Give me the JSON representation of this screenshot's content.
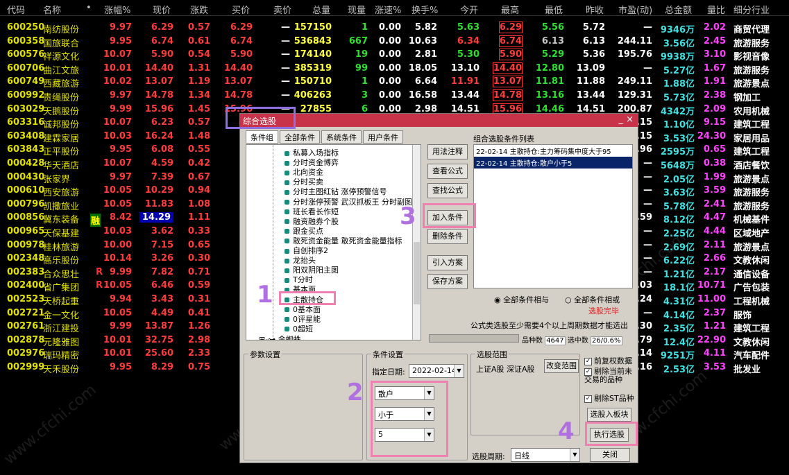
{
  "headers": [
    "代码",
    "名称",
    "•",
    "涨幅%",
    "现价",
    "涨跌",
    "买价",
    "卖价",
    "总量",
    "现量",
    "涨速%",
    "换手%",
    "今开",
    "最高",
    "最低",
    "昨收",
    "市盈(动)",
    "总金额",
    "量比",
    "细分行业"
  ],
  "rows": [
    {
      "code": "600250",
      "name": "南纺股份",
      "flag": "",
      "tag": "",
      "chg": "9.97",
      "price": "6.29",
      "diff": "0.57",
      "bid": "6.29",
      "ask": "—",
      "vol": "157150",
      "cur": "1",
      "spd": "0.00",
      "turn": "5.82",
      "open": "5.63",
      "high": "6.29",
      "low": "5.56",
      "prev": "5.72",
      "pe": "—",
      "amt": "9346万",
      "ratio": "2.02",
      "ind": "商贸代理",
      "openc": "green",
      "lowc": "green"
    },
    {
      "code": "600358",
      "name": "国旅联合",
      "flag": "",
      "tag": "",
      "chg": "9.95",
      "price": "6.74",
      "diff": "0.61",
      "bid": "6.74",
      "ask": "—",
      "vol": "536843",
      "cur": "667",
      "spd": "0.00",
      "turn": "10.63",
      "open": "6.34",
      "high": "6.74",
      "low": "6.13",
      "prev": "6.13",
      "pe": "244.11",
      "amt": "3.56亿",
      "ratio": "2.45",
      "ind": "旅游服务",
      "openc": "red",
      "lowc": "gray"
    },
    {
      "code": "600576",
      "name": "祥源文化",
      "flag": "",
      "tag": "",
      "chg": "10.07",
      "price": "5.90",
      "diff": "0.54",
      "bid": "5.90",
      "ask": "—",
      "vol": "174140",
      "cur": "19",
      "spd": "0.00",
      "turn": "2.81",
      "open": "5.30",
      "high": "5.90",
      "low": "5.29",
      "prev": "5.36",
      "pe": "195.76",
      "amt": "9938万",
      "ratio": "3.10",
      "ind": "影视音像",
      "openc": "green",
      "lowc": "green"
    },
    {
      "code": "600706",
      "name": "曲江文旅",
      "flag": "",
      "tag": "",
      "chg": "10.01",
      "price": "14.40",
      "diff": "1.31",
      "bid": "14.40",
      "ask": "—",
      "vol": "385319",
      "cur": "99",
      "spd": "0.00",
      "turn": "18.05",
      "open": "13.10",
      "high": "14.40",
      "low": "12.80",
      "prev": "13.09",
      "pe": "—",
      "amt": "5.27亿",
      "ratio": "1.67",
      "ind": "旅游服务",
      "openc": "white",
      "lowc": "green"
    },
    {
      "code": "600749",
      "name": "西藏旅游",
      "flag": "",
      "tag": "",
      "chg": "10.02",
      "price": "13.07",
      "diff": "1.19",
      "bid": "13.07",
      "ask": "—",
      "vol": "150710",
      "cur": "1",
      "spd": "0.00",
      "turn": "6.64",
      "open": "11.91",
      "high": "13.07",
      "low": "11.81",
      "prev": "11.88",
      "pe": "249.11",
      "amt": "1.88亿",
      "ratio": "1.91",
      "ind": "旅游景点",
      "openc": "red",
      "lowc": "green"
    },
    {
      "code": "600992",
      "name": "贵绳股份",
      "flag": "",
      "tag": "",
      "chg": "9.97",
      "price": "14.78",
      "diff": "1.34",
      "bid": "14.78",
      "ask": "—",
      "vol": "406263",
      "cur": "3",
      "spd": "0.00",
      "turn": "16.58",
      "open": "13.44",
      "high": "14.78",
      "low": "13.16",
      "prev": "13.44",
      "pe": "129.31",
      "amt": "5.73亿",
      "ratio": "2.38",
      "ind": "钢加工",
      "openc": "white",
      "lowc": "green"
    },
    {
      "code": "603029",
      "name": "天鹅股份",
      "flag": "",
      "tag": "",
      "chg": "9.99",
      "price": "15.96",
      "diff": "1.45",
      "bid": "15.96",
      "ask": "—",
      "vol": "27855",
      "cur": "6",
      "spd": "0.00",
      "turn": "2.98",
      "open": "14.51",
      "high": "15.96",
      "low": "14.46",
      "prev": "14.51",
      "pe": "200.87",
      "amt": "4342万",
      "ratio": "2.09",
      "ind": "农用机械",
      "openc": "white",
      "lowc": "green"
    },
    {
      "code": "603316",
      "name": "诚邦股份",
      "flag": "",
      "tag": "",
      "chg": "10.07",
      "price": "6.23",
      "diff": "0.57",
      "bid": "",
      "ask": "",
      "vol": "",
      "cur": "",
      "spd": "",
      "turn": "",
      "open": "",
      "high": "",
      "low": "",
      "prev": "",
      "pe": ".15",
      "amt": "1.10亿",
      "ratio": "9.15",
      "ind": "建筑工程",
      "openc": "red",
      "lowc": "green"
    },
    {
      "code": "603408",
      "name": "建霖家居",
      "flag": "",
      "tag": "",
      "chg": "10.03",
      "price": "16.24",
      "diff": "1.48",
      "bid": "16",
      "ask": "",
      "vol": "",
      "cur": "",
      "spd": "",
      "turn": "",
      "open": "",
      "high": "",
      "low": "",
      "prev": "",
      "pe": ".15",
      "amt": "3.53亿",
      "ratio": "24.30",
      "ind": "家居用品",
      "openc": "red",
      "lowc": "green"
    },
    {
      "code": "603843",
      "name": "正平股份",
      "flag": "",
      "tag": "",
      "chg": "9.95",
      "price": "6.08",
      "diff": "0.55",
      "bid": "6",
      "ask": "",
      "vol": "",
      "cur": "",
      "spd": "",
      "turn": "",
      "open": "",
      "high": "",
      "low": "",
      "prev": "",
      "pe": ".96",
      "amt": "2595万",
      "ratio": "0.65",
      "ind": "建筑工程",
      "openc": "red",
      "lowc": "green"
    },
    {
      "code": "000428",
      "name": "华天酒店",
      "flag": "",
      "tag": "",
      "chg": "10.07",
      "price": "4.59",
      "diff": "0.42",
      "bid": "",
      "ask": "",
      "vol": "",
      "cur": "",
      "spd": "",
      "turn": "",
      "open": "",
      "high": "",
      "low": "",
      "prev": "",
      "pe": "—",
      "amt": "5648万",
      "ratio": "0.38",
      "ind": "酒店餐饮",
      "openc": "red",
      "lowc": "green"
    },
    {
      "code": "000430",
      "name": "张家界",
      "flag": "",
      "tag": "",
      "chg": "9.97",
      "price": "7.39",
      "diff": "0.67",
      "bid": "",
      "ask": "",
      "vol": "",
      "cur": "",
      "spd": "",
      "turn": "",
      "open": "",
      "high": "",
      "low": "",
      "prev": "",
      "pe": "—",
      "amt": "2.05亿",
      "ratio": "1.99",
      "ind": "旅游景点",
      "openc": "red",
      "lowc": "green"
    },
    {
      "code": "000610",
      "name": "西安旅游",
      "flag": "",
      "tag": "",
      "chg": "10.05",
      "price": "10.29",
      "diff": "0.94",
      "bid": "10",
      "ask": "",
      "vol": "",
      "cur": "",
      "spd": "",
      "turn": "",
      "open": "",
      "high": "",
      "low": "",
      "prev": "",
      "pe": "—",
      "amt": "3.63亿",
      "ratio": "3.59",
      "ind": "旅游服务",
      "openc": "red",
      "lowc": "green"
    },
    {
      "code": "000796",
      "name": "凯撒旅业",
      "flag": "",
      "tag": "",
      "chg": "10.05",
      "price": "11.83",
      "diff": "1.08",
      "bid": "11",
      "ask": "",
      "vol": "",
      "cur": "",
      "spd": "",
      "turn": "",
      "open": "",
      "high": "",
      "low": "",
      "prev": "",
      "pe": "—",
      "amt": "5.78亿",
      "ratio": "2.41",
      "ind": "旅游服务",
      "openc": "red",
      "lowc": "green"
    },
    {
      "code": "000856",
      "name": "冀东装备",
      "flag": "",
      "tag": "融",
      "chg": "8.42",
      "price": "14.29",
      "diff": "1.11",
      "bid": "14",
      "ask": "",
      "vol": "",
      "cur": "",
      "spd": "",
      "turn": "",
      "open": "",
      "high": "",
      "low": "",
      "prev": "",
      "pe": ".59",
      "amt": "8.12亿",
      "ratio": "4.47",
      "ind": "机械基件",
      "openc": "red",
      "lowc": "green"
    },
    {
      "code": "000965",
      "name": "天保基建",
      "flag": "",
      "tag": "",
      "chg": "10.03",
      "price": "3.62",
      "diff": "0.33",
      "bid": "",
      "ask": "",
      "vol": "",
      "cur": "",
      "spd": "",
      "turn": "",
      "open": "",
      "high": "",
      "low": "",
      "prev": "",
      "pe": "—",
      "amt": "2.25亿",
      "ratio": "4.44",
      "ind": "区域地产",
      "openc": "red",
      "lowc": "green"
    },
    {
      "code": "000978",
      "name": "桂林旅游",
      "flag": "",
      "tag": "",
      "chg": "10.00",
      "price": "7.15",
      "diff": "0.65",
      "bid": "",
      "ask": "",
      "vol": "",
      "cur": "",
      "spd": "",
      "turn": "",
      "open": "",
      "high": "",
      "low": "",
      "prev": "",
      "pe": "—",
      "amt": "2.69亿",
      "ratio": "2.11",
      "ind": "旅游景点",
      "openc": "red",
      "lowc": "green"
    },
    {
      "code": "002348",
      "name": "高乐股份",
      "flag": "",
      "tag": "",
      "chg": "10.14",
      "price": "3.26",
      "diff": "0.30",
      "bid": "",
      "ask": "",
      "vol": "",
      "cur": "",
      "spd": "",
      "turn": "",
      "open": "",
      "high": "",
      "low": "",
      "prev": "",
      "pe": "—",
      "amt": "6.22亿",
      "ratio": "2.66",
      "ind": "文教休闲",
      "openc": "red",
      "lowc": "green"
    },
    {
      "code": "002383",
      "name": "合众思壮",
      "flag": "R",
      "tag": "",
      "chg": "9.99",
      "price": "7.82",
      "diff": "0.71",
      "bid": "",
      "ask": "",
      "vol": "",
      "cur": "",
      "spd": "",
      "turn": "",
      "open": "",
      "high": "",
      "low": "",
      "prev": "",
      "pe": "—",
      "amt": "1.21亿",
      "ratio": "2.17",
      "ind": "通信设备",
      "openc": "red",
      "lowc": "green"
    },
    {
      "code": "002400",
      "name": "省广集团",
      "flag": "R",
      "tag": "",
      "chg": "10.05",
      "price": "6.46",
      "diff": "0.59",
      "bid": "",
      "ask": "",
      "vol": "",
      "cur": "",
      "spd": "",
      "turn": "",
      "open": "",
      "high": "",
      "low": "",
      "prev": "",
      "pe": ".03",
      "amt": "18.1亿",
      "ratio": "10.71",
      "ind": "广告包装",
      "openc": "red",
      "lowc": "green"
    },
    {
      "code": "002523",
      "name": "天桥起重",
      "flag": "",
      "tag": "",
      "chg": "9.94",
      "price": "3.43",
      "diff": "0.31",
      "bid": "",
      "ask": "",
      "vol": "",
      "cur": "",
      "spd": "",
      "turn": "",
      "open": "",
      "high": "",
      "low": "",
      "prev": "",
      "pe": ".24",
      "amt": "4.31亿",
      "ratio": "11.00",
      "ind": "工程机械",
      "openc": "red",
      "lowc": "green"
    },
    {
      "code": "002721",
      "name": "金一文化",
      "flag": "",
      "tag": "",
      "chg": "10.05",
      "price": "4.49",
      "diff": "0.41",
      "bid": "",
      "ask": "",
      "vol": "",
      "cur": "",
      "spd": "",
      "turn": "",
      "open": "",
      "high": "",
      "low": "",
      "prev": "",
      "pe": "—",
      "amt": "4.14亿",
      "ratio": "2.37",
      "ind": "服饰",
      "openc": "red",
      "lowc": "green"
    },
    {
      "code": "002761",
      "name": "浙江建投",
      "flag": "",
      "tag": "",
      "chg": "9.99",
      "price": "13.87",
      "diff": "1.26",
      "bid": "13",
      "ask": "",
      "vol": "",
      "cur": "",
      "spd": "",
      "turn": "",
      "open": "",
      "high": "",
      "low": "",
      "prev": "",
      "pe": ".30",
      "amt": "2.35亿",
      "ratio": "1.21",
      "ind": "建筑工程",
      "openc": "red",
      "lowc": "green"
    },
    {
      "code": "002878",
      "name": "元隆雅图",
      "flag": "",
      "tag": "",
      "chg": "10.01",
      "price": "32.75",
      "diff": "2.98",
      "bid": "32",
      "ask": "",
      "vol": "",
      "cur": "",
      "spd": "",
      "turn": "",
      "open": "",
      "high": "",
      "low": "",
      "prev": "",
      "pe": ".79",
      "amt": "12.4亿",
      "ratio": "22.90",
      "ind": "文教休闲",
      "openc": "red",
      "lowc": "green"
    },
    {
      "code": "002976",
      "name": "瑞玛精密",
      "flag": "",
      "tag": "",
      "chg": "10.01",
      "price": "25.60",
      "diff": "2.33",
      "bid": "25",
      "ask": "",
      "vol": "",
      "cur": "",
      "spd": "",
      "turn": "",
      "open": "",
      "high": "",
      "low": "",
      "prev": "",
      "pe": ".14",
      "amt": "9251万",
      "ratio": "4.11",
      "ind": "汽车配件",
      "openc": "red",
      "lowc": "green"
    },
    {
      "code": "002999",
      "name": "天禾股份",
      "flag": "",
      "tag": "",
      "chg": "9.95",
      "price": "8.29",
      "diff": "0.75",
      "bid": "8",
      "ask": "",
      "vol": "",
      "cur": "",
      "spd": "",
      "turn": "",
      "open": "",
      "high": "",
      "low": "",
      "prev": "",
      "pe": ".16",
      "amt": "2.53亿",
      "ratio": "3.53",
      "ind": "批发业",
      "openc": "red",
      "lowc": "green"
    }
  ],
  "dialog": {
    "title": "综合选股",
    "title_ctl": "_ ×",
    "tabs": [
      "条件组",
      "全部条件",
      "系统条件",
      "用户条件"
    ],
    "tree_items": [
      "私募入场指标",
      "分时资金博弈",
      "北向资金",
      "分时买卖",
      "分时主图红钻 涨停预警信号",
      "分时涨停预警 武汉抓板王 分时副图",
      "班长看长作短",
      "融资融券个股",
      "跟金买点",
      "敢死资金能量 敢死资金能量指标",
      "自创排序2",
      "龙抬头",
      "阳双阴阳主图",
      "T分时",
      "基本面",
      "主散持仓",
      "0基本面",
      "0评星能",
      "0超短"
    ],
    "tree_group": "金蜘蛛",
    "buttons": {
      "usage": "用法注释",
      "view_formula": "查看公式",
      "find_formula": "查找公式",
      "add_condition": "加入条件",
      "delete_condition": "删除条件",
      "import_plan": "引入方案",
      "save_plan": "保存方案",
      "change_range": "改变范围",
      "to_block": "选股入板块",
      "run": "执行选股",
      "close": "关闭"
    },
    "list_title": "组合选股条件列表",
    "list_items": [
      "22-02-14 主散持仓:主力筹码集中度大于95",
      "22-02-14 主散持仓:散户小于5"
    ],
    "radio_and": "全部条件相与",
    "radio_or": "全部条件相或",
    "status": "选股完毕",
    "note": "公式类选股至少需要4个以上周期数据才能选出",
    "count_label": "品种数",
    "count_value": "4647",
    "selected_label": "选中数",
    "selected_value": "26/0.6%",
    "progress": 1.0,
    "param_group": "参数设置",
    "cond_group": "条件设置",
    "date_label": "指定日期:",
    "date_value": "2022-02-14",
    "cond1": "散户",
    "cond2": "小于",
    "cond3": "5",
    "range_group": "选股范围",
    "range_text": "上证A股 深证A股",
    "chk_fq": "前复权数据",
    "chk_exclude1": "剔除当前未交易的品种",
    "chk_exclude2": "剔除ST品种",
    "period_label": "选股周期:",
    "period_value": "日线"
  },
  "annotations": [
    "1",
    "2",
    "3",
    "4"
  ],
  "watermark": "www.cfchi.com"
}
